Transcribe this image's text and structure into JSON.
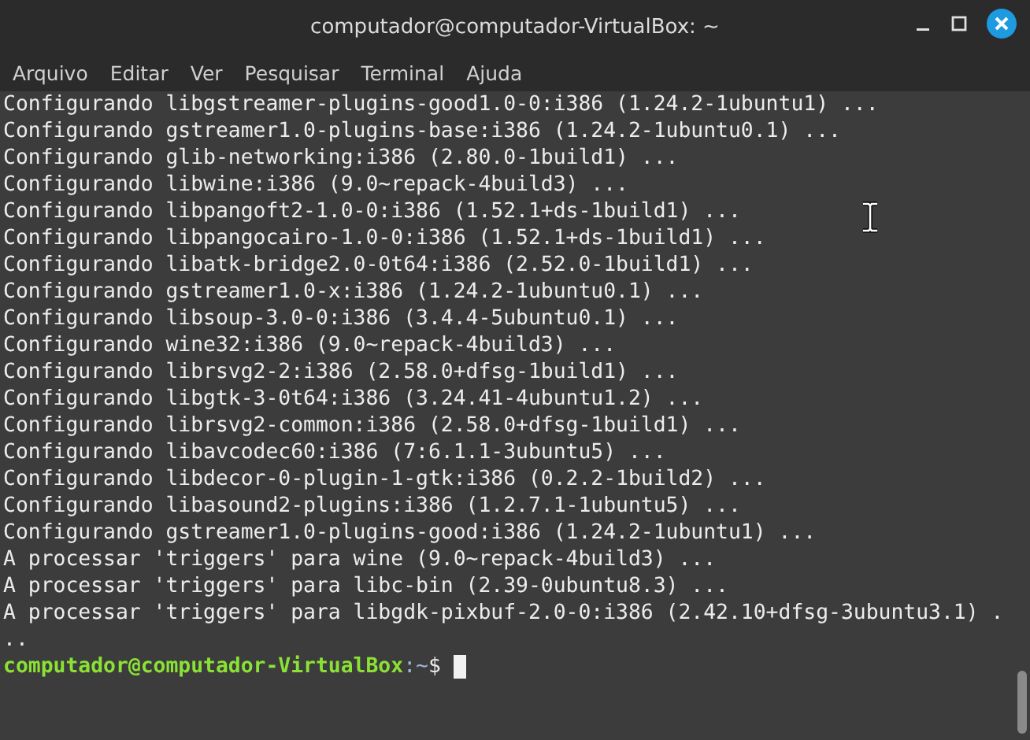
{
  "window": {
    "title": "computador@computador-VirtualBox: ~"
  },
  "menu": [
    "Arquivo",
    "Editar",
    "Ver",
    "Pesquisar",
    "Terminal",
    "Ajuda"
  ],
  "lines": [
    "Configurando libgstreamer-plugins-good1.0-0:i386 (1.24.2-1ubuntu1) ...",
    "Configurando gstreamer1.0-plugins-base:i386 (1.24.2-1ubuntu0.1) ...",
    "Configurando glib-networking:i386 (2.80.0-1build1) ...",
    "Configurando libwine:i386 (9.0~repack-4build3) ...",
    "Configurando libpangoft2-1.0-0:i386 (1.52.1+ds-1build1) ...",
    "Configurando libpangocairo-1.0-0:i386 (1.52.1+ds-1build1) ...",
    "Configurando libatk-bridge2.0-0t64:i386 (2.52.0-1build1) ...",
    "Configurando gstreamer1.0-x:i386 (1.24.2-1ubuntu0.1) ...",
    "Configurando libsoup-3.0-0:i386 (3.4.4-5ubuntu0.1) ...",
    "Configurando wine32:i386 (9.0~repack-4build3) ...",
    "Configurando librsvg2-2:i386 (2.58.0+dfsg-1build1) ...",
    "Configurando libgtk-3-0t64:i386 (3.24.41-4ubuntu1.2) ...",
    "Configurando librsvg2-common:i386 (2.58.0+dfsg-1build1) ...",
    "Configurando libavcodec60:i386 (7:6.1.1-3ubuntu5) ...",
    "Configurando libdecor-0-plugin-1-gtk:i386 (0.2.2-1build2) ...",
    "Configurando libasound2-plugins:i386 (1.2.7.1-1ubuntu5) ...",
    "Configurando gstreamer1.0-plugins-good:i386 (1.24.2-1ubuntu1) ...",
    "A processar 'triggers' para wine (9.0~repack-4build3) ...",
    "A processar 'triggers' para libc-bin (2.39-0ubuntu8.3) ...",
    "A processar 'triggers' para libgdk-pixbuf-2.0-0:i386 (2.42.10+dfsg-3ubuntu3.1) .",
    ".."
  ],
  "prompt": {
    "user_host": "computador@computador-VirtualBox",
    "path": ":~",
    "symbol": "$"
  }
}
